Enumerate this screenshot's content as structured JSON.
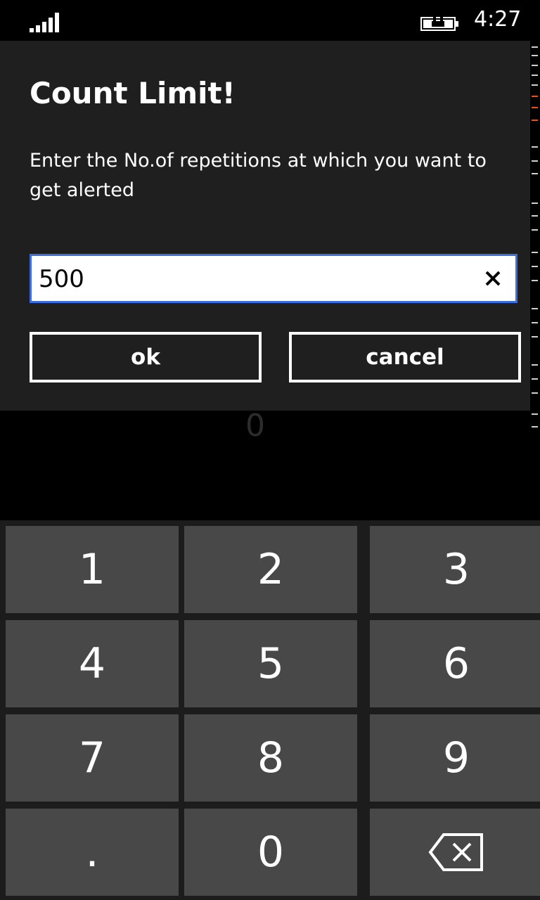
{
  "status_bar": {
    "time": "4:27",
    "signal_icon": "signal-strength-icon",
    "battery_icon": "battery-charging-icon"
  },
  "dialog": {
    "title": "Count Limit!",
    "message": "Enter the No.of repetitions at which you want to get alerted",
    "input_value": "500",
    "clear_icon": "close-icon",
    "ok_label": "ok",
    "cancel_label": "cancel",
    "input_border_color": "#3b6dde"
  },
  "counter": {
    "value": "0"
  },
  "keypad": {
    "keys": [
      "1",
      "2",
      "3",
      "4",
      "5",
      "6",
      "7",
      "8",
      "9",
      ".",
      "0"
    ],
    "backspace_icon": "backspace-icon"
  }
}
